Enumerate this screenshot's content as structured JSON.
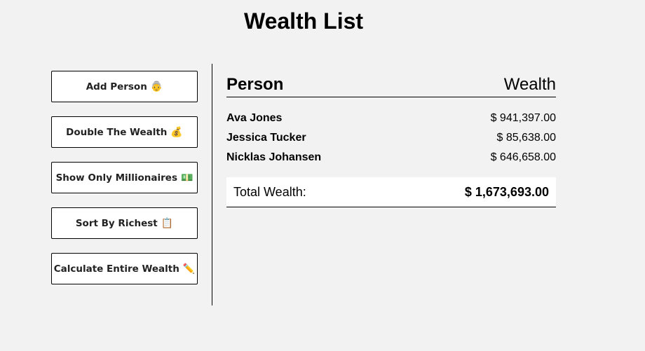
{
  "page": {
    "title": "Wealth List"
  },
  "actions": [
    {
      "label": "Add Person",
      "emoji": "👵",
      "icon": "old-woman-emoji-icon"
    },
    {
      "label": "Double The Wealth",
      "emoji": "💰",
      "icon": "money-bag-emoji-icon"
    },
    {
      "label": "Show Only Millionaires",
      "emoji": "💵",
      "icon": "dollar-banknote-emoji-icon"
    },
    {
      "label": "Sort By Richest",
      "emoji": "📋",
      "icon": "clipboard-emoji-icon"
    },
    {
      "label": "Calculate Entire Wealth",
      "emoji": "✏️",
      "icon": "pencil-emoji-icon"
    }
  ],
  "table": {
    "header_person": "Person",
    "header_wealth": "Wealth",
    "rows": [
      {
        "name": "Ava Jones",
        "wealth": "$ 941,397.00"
      },
      {
        "name": "Jessica Tucker",
        "wealth": "$ 85,638.00"
      },
      {
        "name": "Nicklas Johansen",
        "wealth": "$ 646,658.00"
      }
    ]
  },
  "total": {
    "label": "Total Wealth:",
    "value": "$ 1,673,693.00"
  }
}
